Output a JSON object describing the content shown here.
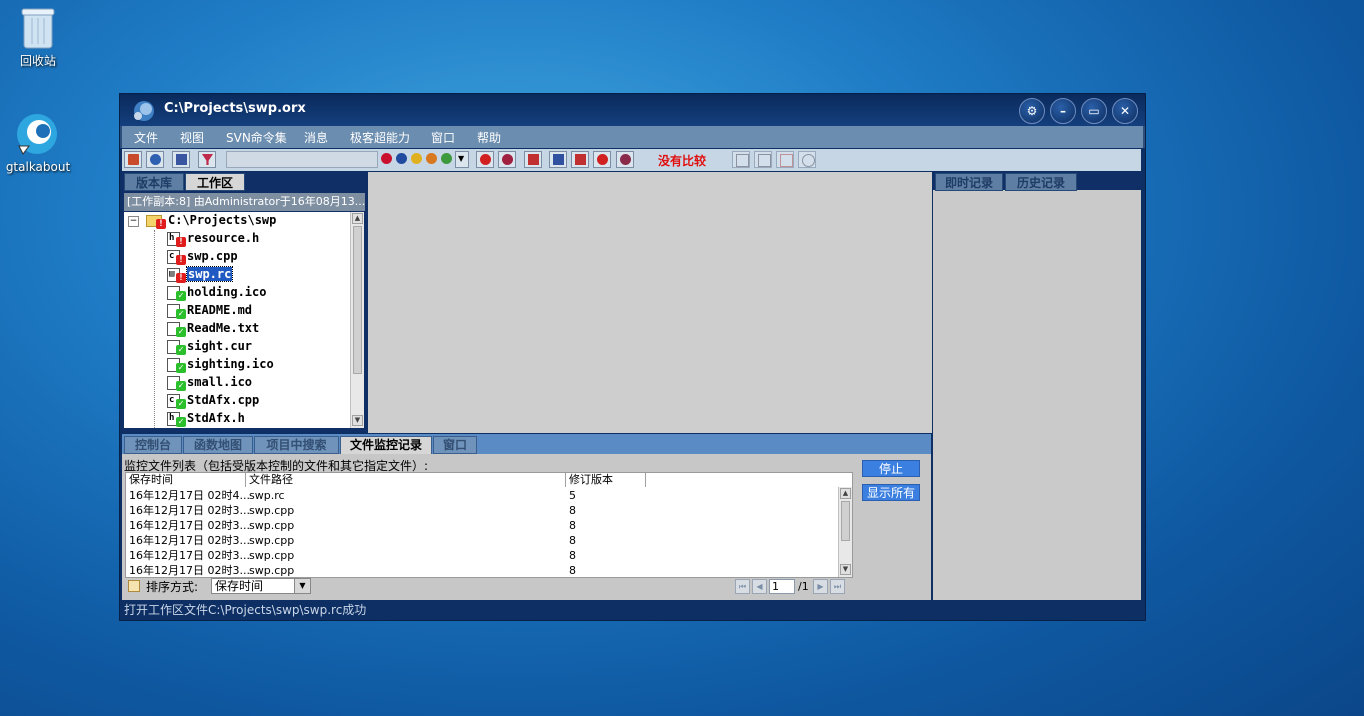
{
  "desktop": {
    "icons": [
      {
        "label": "回收站"
      },
      {
        "label": "gtalkabout"
      }
    ]
  },
  "window": {
    "title": "C:\\Projects\\swp.orx",
    "controls": [
      "settings",
      "minimize",
      "maximize",
      "close"
    ]
  },
  "menu": [
    "文件",
    "视图",
    "SVN命令集",
    "消息",
    "极客超能力",
    "窗口",
    "帮助"
  ],
  "toolbar": {
    "no_compare": "没有比较"
  },
  "left_panel": {
    "tabs": [
      "版本库",
      "工作区"
    ],
    "active_tab": "工作区",
    "working_copy_bar": "[工作副本:8] 由Administrator于16年08月13...",
    "tree": [
      {
        "name": "C:\\Projects\\swp",
        "type": "folder",
        "status": "warn"
      },
      {
        "name": "resource.h",
        "type": "h",
        "status": "warn"
      },
      {
        "name": "swp.cpp",
        "type": "c++",
        "status": "warn"
      },
      {
        "name": "swp.rc",
        "type": "rc",
        "status": "warn",
        "selected": true
      },
      {
        "name": "holding.ico",
        "type": "file",
        "status": "ok"
      },
      {
        "name": "README.md",
        "type": "file",
        "status": "ok"
      },
      {
        "name": "ReadMe.txt",
        "type": "file",
        "status": "ok"
      },
      {
        "name": "sight.cur",
        "type": "file",
        "status": "ok"
      },
      {
        "name": "sighting.ico",
        "type": "file",
        "status": "ok"
      },
      {
        "name": "small.ico",
        "type": "file",
        "status": "ok"
      },
      {
        "name": "StdAfx.cpp",
        "type": "c++",
        "status": "ok"
      },
      {
        "name": "StdAfx.h",
        "type": "h",
        "status": "ok"
      }
    ]
  },
  "right_panel": {
    "tabs": [
      "即时记录",
      "历史记录"
    ]
  },
  "bottom_pane": {
    "tabs": [
      "控制台",
      "函数地图",
      "项目中搜索",
      "文件监控记录",
      "窗口"
    ],
    "active_tab": "文件监控记录",
    "label": "监控文件列表（包括受版本控制的文件和其它指定文件）:",
    "columns": [
      "保存时间",
      "文件路径",
      "修订版本"
    ],
    "rows": [
      [
        "16年12月17日 02时4...",
        "swp.rc",
        "5"
      ],
      [
        "16年12月17日 02时3...",
        "swp.cpp",
        "8"
      ],
      [
        "16年12月17日 02时3...",
        "swp.cpp",
        "8"
      ],
      [
        "16年12月17日 02时3...",
        "swp.cpp",
        "8"
      ],
      [
        "16年12月17日 02时3...",
        "swp.cpp",
        "8"
      ],
      [
        "16年12月17日 02时3...",
        "swp.cpp",
        "8"
      ]
    ],
    "buttons": {
      "stop": "停止",
      "show_all": "显示所有"
    },
    "sort_label": "排序方式:",
    "sort_value": "保存时间",
    "page_current": "1",
    "page_total": "/1"
  },
  "status_bar": "打开工作区文件C:\\Projects\\swp\\swp.rc成功",
  "colors": {
    "accent": "#3b7fe0",
    "window_frame": "#0e2f63",
    "warn": "#e01c1c",
    "ok": "#2cbf2c"
  }
}
